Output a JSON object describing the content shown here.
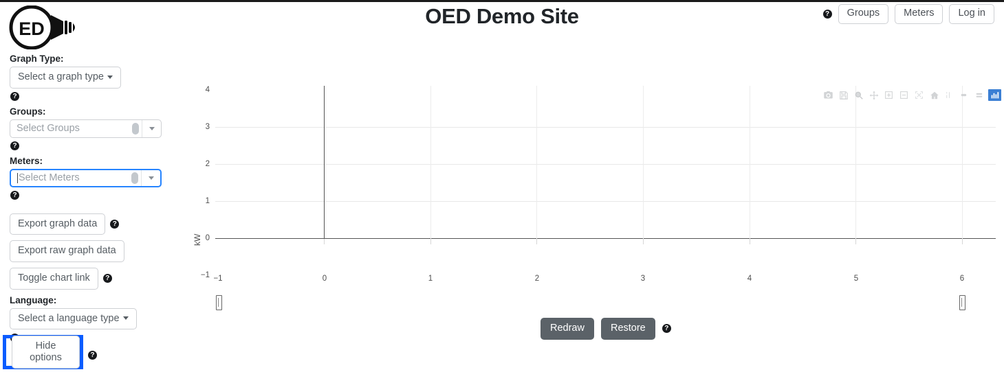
{
  "header": {
    "title": "OED Demo Site",
    "logo_text": "ED",
    "help_icon": "help-circle-icon",
    "buttons": [
      {
        "label": "Groups",
        "name": "groups-nav-button"
      },
      {
        "label": "Meters",
        "name": "meters-nav-button"
      },
      {
        "label": "Log in",
        "name": "login-button"
      }
    ]
  },
  "sidebar": {
    "graph_type": {
      "label": "Graph Type:",
      "selected": "Select a graph type"
    },
    "groups": {
      "label": "Groups:",
      "placeholder": "Select Groups"
    },
    "meters": {
      "label": "Meters:",
      "placeholder": "Select Meters"
    },
    "export_graph": "Export graph data",
    "export_raw": "Export raw graph data",
    "toggle_chart_link": "Toggle chart link",
    "language": {
      "label": "Language:",
      "selected": "Select a language type"
    },
    "hide_options": "Hide options"
  },
  "controls": {
    "redraw": "Redraw",
    "restore": "Restore"
  },
  "modebar": {
    "buttons": [
      {
        "name": "download-camera-icon",
        "label": "Download plot as a png"
      },
      {
        "name": "save-disk-icon",
        "label": "Edit in Chart Studio"
      },
      {
        "name": "zoom-magnifier-icon",
        "label": "Zoom"
      },
      {
        "name": "pan-move-icon",
        "label": "Pan"
      },
      {
        "name": "zoom-in-icon",
        "label": "Zoom in"
      },
      {
        "name": "zoom-out-icon",
        "label": "Zoom out"
      },
      {
        "name": "autoscale-icon",
        "label": "Autoscale"
      },
      {
        "name": "reset-home-icon",
        "label": "Reset axes"
      },
      {
        "name": "spike-lines-icon",
        "label": "Toggle Spike Lines"
      },
      {
        "name": "hover-compare-icon",
        "label": "Show closest data on hover"
      },
      {
        "name": "hover-compare-data-icon",
        "label": "Compare data on hover"
      },
      {
        "name": "plotly-logo-icon",
        "label": "Produced with Plotly"
      }
    ]
  },
  "chart_data": {
    "type": "line",
    "title": "",
    "xlabel": "",
    "ylabel": "kW",
    "xtick_labels": [
      "−1",
      "0",
      "1",
      "2",
      "3",
      "4",
      "5",
      "6"
    ],
    "xtick_values": [
      -1,
      0,
      1,
      2,
      3,
      4,
      5,
      6
    ],
    "ytick_labels": [
      "−1",
      "0",
      "1",
      "2",
      "3",
      "4"
    ],
    "ytick_values": [
      -1,
      0,
      1,
      2,
      3,
      4
    ],
    "xlim": [
      -1,
      6
    ],
    "ylim": [
      -1,
      4
    ],
    "series": [],
    "grid": true,
    "legend": "none",
    "rangeslider": true,
    "note": "empty plot - no meters or groups selected, so no data series are drawn"
  },
  "annotation": {
    "highlight_color": "#0a5cff",
    "highlighted_element": "hide-options-button"
  },
  "colors": {
    "accent_blue": "#2684ff",
    "button_gray": "#5b6268",
    "zeroline": "#545454",
    "gridline": "#e8e8e8"
  }
}
